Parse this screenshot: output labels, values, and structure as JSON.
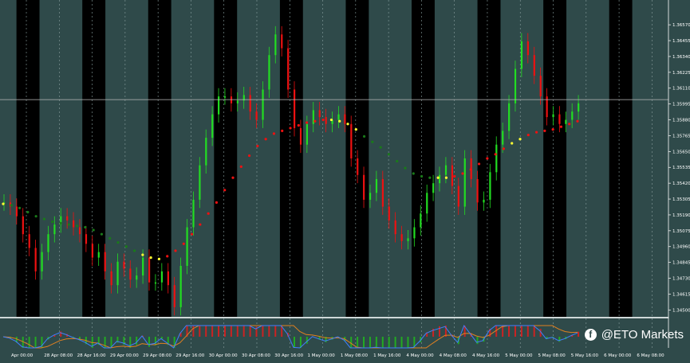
{
  "watermark": {
    "label": "@ETO Markets",
    "icon": "facebook-icon"
  },
  "colors": {
    "background": "#2f4a4a",
    "session_band": "#000000",
    "bull_candle": "#22dd22",
    "bear_candle": "#ee1111",
    "trend_line_up": "#ee1111",
    "trend_line_down": "#1a7a1a",
    "trend_switch": "#ffff33",
    "current_price_line": "#bbbbbb",
    "macd_pos": "#cc2222",
    "macd_neg": "#22aa22",
    "signal_a": "#e08020",
    "signal_b": "#4080ff",
    "axis_text": "#ffffff"
  },
  "chart_data": {
    "type": "candlestick",
    "title": "",
    "xlabel": "",
    "ylabel": "",
    "ylim": [
      1.3445,
      1.3675
    ],
    "current_price": 1.36027,
    "y_ticks": [
      "1.36570",
      "1.36455",
      "1.36340",
      "1.36225",
      "1.36110",
      "1.35995",
      "1.35880",
      "1.35765",
      "1.35650",
      "1.35535",
      "1.35420",
      "1.35305",
      "1.35190",
      "1.35075",
      "1.34960",
      "1.34845",
      "1.34730",
      "1.34615",
      "1.34500"
    ],
    "y_tick_values": [
      1.3657,
      1.36455,
      1.3634,
      1.36225,
      1.3611,
      1.35995,
      1.3588,
      1.35765,
      1.3565,
      1.35535,
      1.3542,
      1.35305,
      1.3519,
      1.35075,
      1.3496,
      1.34845,
      1.3473,
      1.34615,
      1.345
    ],
    "x_labels": [
      "Apr 00:00",
      "28 Apr 08:00",
      "28 Apr 16:00",
      "29 Apr 00:00",
      "29 Apr 08:00",
      "29 Apr 16:00",
      "30 Apr 00:00",
      "30 Apr 08:00",
      "30 Apr 16:00",
      "1 May 00:00",
      "1 May 08:00",
      "1 May 16:00",
      "4 May 00:00",
      "4 May 08:00",
      "4 May 16:00",
      "5 May 00:00",
      "5 May 08:00",
      "5 May 16:00",
      "6 May 00:00",
      "6 May 08:00",
      "6 May 16:00",
      "7 May 00:00"
    ],
    "x_label_pos": [
      0.5,
      2.5,
      4.5,
      6.5,
      8.5,
      10.5,
      12.5,
      14.5,
      16.5,
      18.5,
      20.5,
      22.5,
      24.5,
      26.5,
      28.5,
      30.5,
      32.5,
      34.5,
      36.5,
      38.5,
      40.5,
      42.5
    ],
    "close_series": [
      1.3528,
      1.3525,
      1.3518,
      1.3505,
      1.3495,
      1.3478,
      1.3492,
      1.3505,
      1.3512,
      1.3518,
      1.3515,
      1.351,
      1.3505,
      1.3498,
      1.3488,
      1.3492,
      1.3478,
      1.3468,
      1.3485,
      1.348,
      1.3472,
      1.3475,
      1.3488,
      1.347,
      1.347,
      1.3478,
      1.3468,
      1.3452,
      1.3482,
      1.351,
      1.353,
      1.3555,
      1.3575,
      1.3592,
      1.3605,
      1.3605,
      1.36,
      1.3602,
      1.3606,
      1.3594,
      1.3588,
      1.361,
      1.3635,
      1.365,
      1.364,
      1.361,
      1.3582,
      1.357,
      1.3585,
      1.3595,
      1.359,
      1.3585,
      1.3588,
      1.3592,
      1.3585,
      1.356,
      1.3548,
      1.353,
      1.3535,
      1.3545,
      1.3525,
      1.3515,
      1.3505,
      1.35,
      1.3502,
      1.351,
      1.352,
      1.3535,
      1.3542,
      1.3548,
      1.3555,
      1.354,
      1.3525,
      1.356,
      1.3545,
      1.3528,
      1.353,
      1.355,
      1.357,
      1.358,
      1.36,
      1.3625,
      1.3645,
      1.3635,
      1.362,
      1.3605,
      1.359,
      1.3592,
      1.3585,
      1.3588,
      1.3594,
      1.36
    ],
    "series": [
      {
        "values": [
          1.3527,
          1.3526,
          1.3524,
          1.3521,
          1.3518,
          1.3516,
          1.3514,
          1.3513,
          1.3512,
          1.3511,
          1.351,
          1.3508,
          1.3505,
          1.3502,
          1.3499,
          1.3496,
          1.3493,
          1.349,
          1.3488,
          1.3487,
          1.3489,
          1.3493,
          1.3498,
          1.3505,
          1.3512,
          1.352,
          1.3528,
          1.3537,
          1.3546,
          1.3554,
          1.3562,
          1.3569,
          1.3574,
          1.3578,
          1.358,
          1.3582,
          1.3584,
          1.3586,
          1.3587,
          1.3588,
          1.3588,
          1.3587,
          1.3585,
          1.3581,
          1.3576,
          1.3572,
          1.3568,
          1.3563,
          1.3558,
          1.3553,
          1.3549,
          1.3547,
          1.3546,
          1.3546,
          1.3546,
          1.3547,
          1.3549,
          1.3552,
          1.3556,
          1.356,
          1.3563,
          1.3567,
          1.3571,
          1.3574,
          1.3577,
          1.3579,
          1.358,
          1.3581,
          1.3583,
          1.3585,
          1.3587
        ]
      }
    ],
    "band_ranges": [
      [
        0,
        2
      ],
      [
        4,
        6
      ],
      [
        8,
        10
      ],
      [
        12,
        14
      ],
      [
        16,
        18
      ],
      [
        20,
        22
      ],
      [
        24,
        26
      ],
      [
        28,
        30
      ],
      [
        32,
        34
      ],
      [
        36,
        38
      ],
      [
        40,
        42
      ],
      [
        44,
        46
      ]
    ],
    "grid": true
  }
}
